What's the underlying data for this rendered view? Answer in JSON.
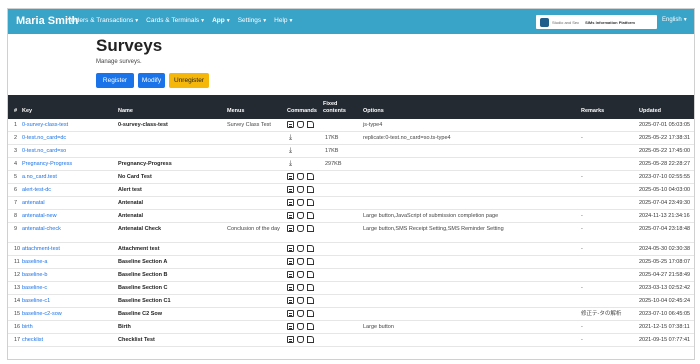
{
  "navbar": {
    "brand": "Maria Smith",
    "items": [
      {
        "label": "Holders & Transactions"
      },
      {
        "label": "Cards & Terminals"
      },
      {
        "label": "App"
      },
      {
        "label": "Settings"
      },
      {
        "label": "Help"
      }
    ],
    "logo_text_1": "Studio and Sec",
    "logo_text_2": "SIMs Information Platform",
    "language": "English"
  },
  "page": {
    "title": "Surveys",
    "subtitle": "Manage surveys."
  },
  "buttons": {
    "register": "Register",
    "modify": "Modify",
    "unregister": "Unregister"
  },
  "table": {
    "headers": {
      "num": "#",
      "key": "Key",
      "name": "Name",
      "menus": "Menus",
      "commands": "Commands",
      "fixed_contents": "Fixed contents",
      "options": "Options",
      "remarks": "Remarks",
      "updated": "Updated"
    },
    "rows": [
      {
        "num": "1",
        "key": "0-survey-class-test",
        "name": "0-survey-class-test",
        "menus": "Survey Class Test",
        "cmd": "edit",
        "fixed": "",
        "options": "js-type4",
        "remarks": "",
        "updated": "2025-07-01 05:03:05"
      },
      {
        "num": "2",
        "key": "0-test.no_card=dc",
        "name": "",
        "menus": "",
        "cmd": "download",
        "fixed": "17KB",
        "options": "replicate:0-test.no_card=so.ts-type4",
        "remarks": "-",
        "updated": "2025-05-22 17:38:31"
      },
      {
        "num": "3",
        "key": "0-test.no_card=so",
        "name": "",
        "menus": "",
        "cmd": "download",
        "fixed": "17KB",
        "options": "",
        "remarks": "",
        "updated": "2025-05-22 17:45:00"
      },
      {
        "num": "4",
        "key": "Pregnancy-Progress",
        "name": "Pregnancy-Progress",
        "menus": "",
        "cmd": "download",
        "fixed": "297KB",
        "options": "",
        "remarks": "",
        "updated": "2025-05-28 22:28:27"
      },
      {
        "num": "5",
        "key": "a.no_card.test",
        "name": "No Card Test",
        "menus": "",
        "cmd": "edit",
        "fixed": "",
        "options": "",
        "remarks": "-",
        "updated": "2023-07-10 02:55:55"
      },
      {
        "num": "6",
        "key": "alert-test-dc",
        "name": "Alert test",
        "menus": "",
        "cmd": "edit",
        "fixed": "",
        "options": "",
        "remarks": "",
        "updated": "2025-05-10 04:03:00"
      },
      {
        "num": "7",
        "key": "antenatal",
        "name": "Antenatal",
        "menus": "",
        "cmd": "edit",
        "fixed": "",
        "options": "",
        "remarks": "",
        "updated": "2025-07-04 23:49:30"
      },
      {
        "num": "8",
        "key": "antenatal-new",
        "name": "Antenatal",
        "menus": "",
        "cmd": "edit",
        "fixed": "",
        "options": "Large button,JavaScript of submission completion page",
        "remarks": "-",
        "updated": "2024-11-13 21:34:16"
      },
      {
        "num": "9",
        "key": "antenatal-check",
        "name": "Antenatal Check",
        "menus": "Conclusion of the day",
        "cmd": "edit",
        "fixed": "",
        "options": "Large button,SMS Receipt Setting,SMS Reminder Setting",
        "remarks": "-",
        "updated": "2025-07-04 23:18:48"
      },
      {
        "num": "10",
        "key": "attachment-test",
        "name": "Attachment test",
        "menus": "",
        "cmd": "edit",
        "fixed": "",
        "options": "",
        "remarks": "-",
        "updated": "2024-05-30 02:30:38"
      },
      {
        "num": "11",
        "key": "baseline-a",
        "name": "Baseline Section A",
        "menus": "",
        "cmd": "edit",
        "fixed": "",
        "options": "",
        "remarks": "",
        "updated": "2025-05-25 17:08:07"
      },
      {
        "num": "12",
        "key": "baseline-b",
        "name": "Baseline Section B",
        "menus": "",
        "cmd": "edit",
        "fixed": "",
        "options": "",
        "remarks": "",
        "updated": "2025-04-27 21:58:49"
      },
      {
        "num": "13",
        "key": "baseline-c",
        "name": "Baseline Section C",
        "menus": "",
        "cmd": "edit",
        "fixed": "",
        "options": "",
        "remarks": "-",
        "updated": "2023-03-13 02:52:42"
      },
      {
        "num": "14",
        "key": "baseline-c1",
        "name": "Baseline Section C1",
        "menus": "",
        "cmd": "edit",
        "fixed": "",
        "options": "",
        "remarks": "",
        "updated": "2025-10-04 02:45:24"
      },
      {
        "num": "15",
        "key": "baseline-c2-sow",
        "name": "Baseline C2 Sow",
        "menus": "",
        "cmd": "edit",
        "fixed": "",
        "options": "",
        "remarks": "修正テ-タの解析",
        "updated": "2023-07-10 06:45:05"
      },
      {
        "num": "16",
        "key": "birth",
        "name": "Birth",
        "menus": "",
        "cmd": "edit",
        "fixed": "",
        "options": "Large button",
        "remarks": "-",
        "updated": "2021-12-15 07:38:11"
      },
      {
        "num": "17",
        "key": "checklist",
        "name": "Checklist Test",
        "menus": "",
        "cmd": "edit",
        "fixed": "",
        "options": "",
        "remarks": "-",
        "updated": "2021-09-15 07:77:41"
      }
    ]
  },
  "colors": {
    "navbar": "#3aa3c8",
    "primary": "#1a73e8",
    "warning": "#f5b70a",
    "table_header": "#232a31"
  }
}
